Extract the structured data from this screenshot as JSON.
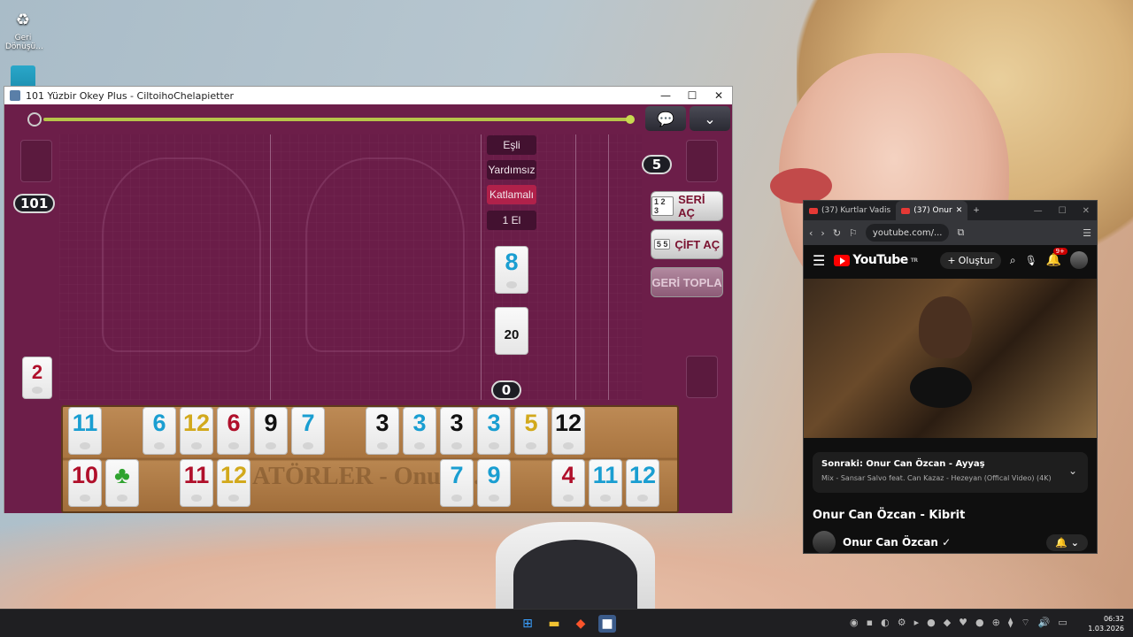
{
  "desktop": {
    "icons": [
      {
        "label": "Geri Dönüşü...",
        "icon": "recycle-bin-icon"
      },
      {
        "label": "",
        "icon": "monitor-icon"
      }
    ]
  },
  "game_window": {
    "title": "101 Yüzbir Okey Plus - CiltoihoChelapietter",
    "controls": {
      "minimize": "—",
      "maximize": "☐",
      "close": "✕"
    },
    "scores": {
      "left_score": "101",
      "right_score": "5",
      "center_count": "0"
    },
    "modes": [
      "Eşli",
      "Yardımsız",
      "Katlamalı",
      "1 El"
    ],
    "active_mode_index": 2,
    "buttons": {
      "seri_ac": "SERİ AÇ",
      "cift_ac": "ÇİFT AÇ",
      "geri_topla": "GERİ TOPLA",
      "seri_cards": "1 2 3",
      "cift_cards": "5 5"
    },
    "indicator_tile": {
      "value": "8",
      "color": "blue"
    },
    "deck_tile": {
      "value": "20",
      "color": "black"
    },
    "discard_tile": {
      "value": "2",
      "color": "red"
    },
    "rack_brand_text": "ATÖRLER - Onur Z.",
    "rack_top": [
      {
        "value": "11",
        "color": "blue"
      },
      {
        "value": "6",
        "color": "blue"
      },
      {
        "value": "12",
        "color": "yellow"
      },
      {
        "value": "6",
        "color": "red"
      },
      {
        "value": "9",
        "color": "black"
      },
      {
        "value": "7",
        "color": "blue"
      },
      {
        "value": "3",
        "color": "black"
      },
      {
        "value": "3",
        "color": "blue"
      },
      {
        "value": "3",
        "color": "black"
      },
      {
        "value": "3",
        "color": "blue"
      },
      {
        "value": "5",
        "color": "yellow"
      },
      {
        "value": "12",
        "color": "black"
      }
    ],
    "rack_bottom": [
      {
        "value": "10",
        "color": "red"
      },
      {
        "value": "♣",
        "color": "green"
      },
      {
        "value": "11",
        "color": "red"
      },
      {
        "value": "12",
        "color": "yellow"
      },
      {
        "value": "7",
        "color": "blue"
      },
      {
        "value": "9",
        "color": "blue"
      },
      {
        "value": "4",
        "color": "red"
      },
      {
        "value": "11",
        "color": "blue"
      },
      {
        "value": "12",
        "color": "blue"
      }
    ]
  },
  "browser": {
    "tabs": [
      {
        "label": "(37) Kurtlar Vadis"
      },
      {
        "label": "(37) Onur"
      }
    ],
    "url": "youtube.com/...",
    "youtube": {
      "logo_text": "YouTube",
      "region": "TR",
      "create_label": "Oluştur",
      "notification_count": "9+",
      "next_title": "Sonraki: Onur Can Özcan - Ayyaş",
      "next_subtitle": "Mix - Sansar Salvo feat. Can Kazaz - Hezeyan (Offical Video) (4K)",
      "video_title": "Onur Can Özcan - Kibrit",
      "channel_name": "Onur Can Özcan ✓"
    }
  },
  "taskbar": {
    "time": "06:32",
    "date": "1.03.2026"
  },
  "colors": {
    "game_bg": "#6c1e49",
    "tile_blue": "#1a9ed1",
    "tile_red": "#b0102b",
    "tile_black": "#111111",
    "tile_yellow": "#d2a91c",
    "tile_green": "#2fa32f"
  }
}
